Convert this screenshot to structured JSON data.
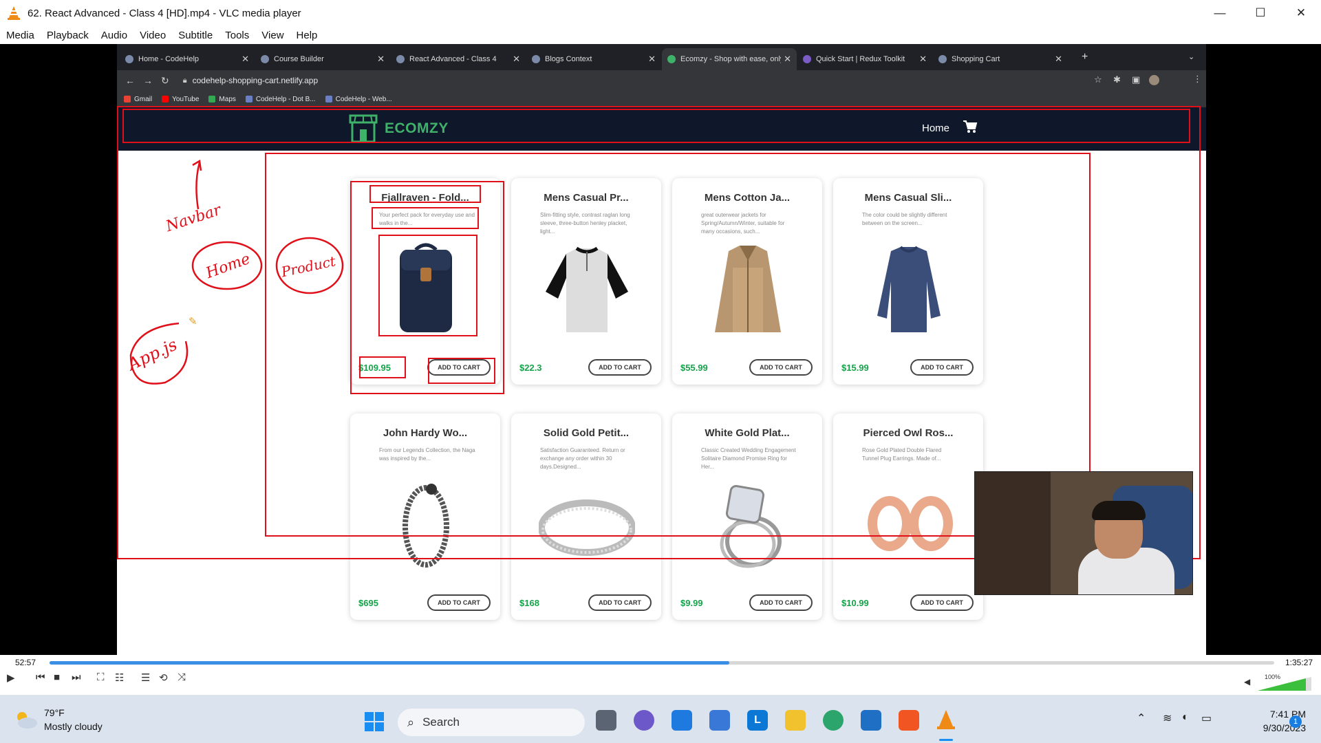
{
  "window": {
    "title": "62. React Advanced - Class 4 [HD].mp4 - VLC media player",
    "minimize": "—",
    "maximize": "☐",
    "close": "✕"
  },
  "menu": [
    "Media",
    "Playback",
    "Audio",
    "Video",
    "Subtitle",
    "Tools",
    "View",
    "Help"
  ],
  "browser": {
    "tabs": [
      {
        "label": "Home - CodeHelp",
        "active": false
      },
      {
        "label": "Course Builder",
        "active": false
      },
      {
        "label": "React Advanced - Class 4",
        "active": false
      },
      {
        "label": "Blogs Context",
        "active": false
      },
      {
        "label": "Ecomzy - Shop with ease, only",
        "active": true
      },
      {
        "label": "Quick Start | Redux Toolkit",
        "active": false
      },
      {
        "label": "Shopping Cart",
        "active": false
      }
    ],
    "url": "codehelp-shopping-cart.netlify.app",
    "bookmarks": [
      {
        "label": "Gmail",
        "color": "#ea4335"
      },
      {
        "label": "YouTube",
        "color": "#ff0000"
      },
      {
        "label": "Maps",
        "color": "#34a853"
      },
      {
        "label": "CodeHelp - Dot B...",
        "color": "#6b7fc4"
      },
      {
        "label": "CodeHelp - Web...",
        "color": "#6b7fc4"
      }
    ]
  },
  "site": {
    "logo": "ECOMZY",
    "nav_home": "Home",
    "button_label": "ADD TO CART",
    "products": [
      {
        "title": "Fjallraven - Fold...",
        "desc": "Your perfect pack for everyday use and walks in the...",
        "price": "$109.95",
        "image": "backpack"
      },
      {
        "title": "Mens Casual Pr...",
        "desc": "Slim-fitting style, contrast raglan long sleeve, three-button henley placket, light...",
        "price": "$22.3",
        "image": "shirt"
      },
      {
        "title": "Mens Cotton Ja...",
        "desc": "great outerwear jackets for Spring/Autumn/Winter, suitable for many occasions, such...",
        "price": "$55.99",
        "image": "jacket"
      },
      {
        "title": "Mens Casual Sli...",
        "desc": "The color could be slightly different between on the screen...",
        "price": "$15.99",
        "image": "sweater"
      },
      {
        "title": "John Hardy Wo...",
        "desc": "From our Legends Collection, the Naga was inspired by the...",
        "price": "$695",
        "image": "bracelet"
      },
      {
        "title": "Solid Gold Petit...",
        "desc": "Satisfaction Guaranteed. Return or exchange any order within 30 days.Designed...",
        "price": "$168",
        "image": "ring"
      },
      {
        "title": "White Gold Plat...",
        "desc": "Classic Created Wedding Engagement Solitaire Diamond Promise Ring for Her...",
        "price": "$9.99",
        "image": "diamond-ring"
      },
      {
        "title": "Pierced Owl Ros...",
        "desc": "Rose Gold Plated Double Flared Tunnel Plug Earrings. Made of...",
        "price": "$10.99",
        "image": "earrings"
      }
    ],
    "annotations": [
      "Navbar",
      "Home",
      "Product",
      "App.js"
    ]
  },
  "player": {
    "elapsed": "52:57",
    "total": "1:35:27",
    "progress": 0.555,
    "volume": "100%"
  },
  "taskbar": {
    "temperature": "79°F",
    "weather": "Mostly cloudy",
    "search": "Search",
    "time": "7:41 PM",
    "date": "9/30/2023",
    "notifications": "1"
  }
}
